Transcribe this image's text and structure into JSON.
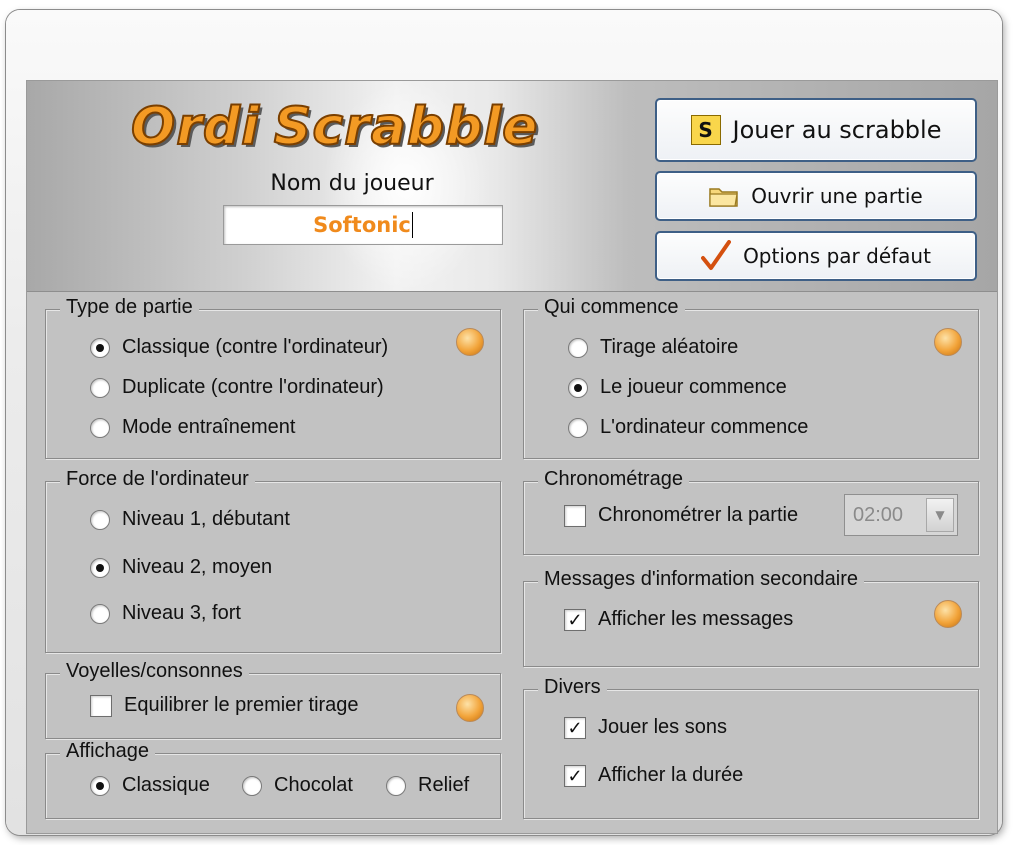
{
  "app": {
    "logo_word1": "Ordi",
    "logo_word2": "Scrabble"
  },
  "player": {
    "label": "Nom du joueur",
    "value": "Softonic"
  },
  "buttons": {
    "play": "Jouer au scrabble",
    "play_icon_letter": "S",
    "open": "Ouvrir une partie",
    "defaults": "Options par défaut"
  },
  "game_type": {
    "legend": "Type de partie",
    "options": [
      "Classique (contre l'ordinateur)",
      "Duplicate (contre l'ordinateur)",
      "Mode entraînement"
    ],
    "selected": 0
  },
  "who_starts": {
    "legend": "Qui commence",
    "options": [
      "Tirage aléatoire",
      "Le joueur commence",
      "L'ordinateur commence"
    ],
    "selected": 1
  },
  "strength": {
    "legend": "Force de l'ordinateur",
    "options": [
      "Niveau 1, débutant",
      "Niveau 2, moyen",
      "Niveau 3, fort"
    ],
    "selected": 1
  },
  "timing": {
    "legend": "Chronométrage",
    "checkbox_label": "Chronométrer la partie",
    "checked": false,
    "time_value": "02:00"
  },
  "messages": {
    "legend": "Messages d'information secondaire",
    "checkbox_label": "Afficher les messages",
    "checked": true
  },
  "vowels": {
    "legend": "Voyelles/consonnes",
    "checkbox_label": "Equilibrer le premier tirage",
    "checked": false
  },
  "misc": {
    "legend": "Divers",
    "options": [
      "Jouer les sons",
      "Afficher la durée"
    ],
    "checked": [
      true,
      true
    ]
  },
  "display": {
    "legend": "Affichage",
    "options": [
      "Classique",
      "Chocolat",
      "Relief"
    ],
    "selected": 0
  },
  "colors": {
    "accent_orange": "#f39a24",
    "button_border": "#3e5f86",
    "panel_gray": "#c2c2c2"
  }
}
